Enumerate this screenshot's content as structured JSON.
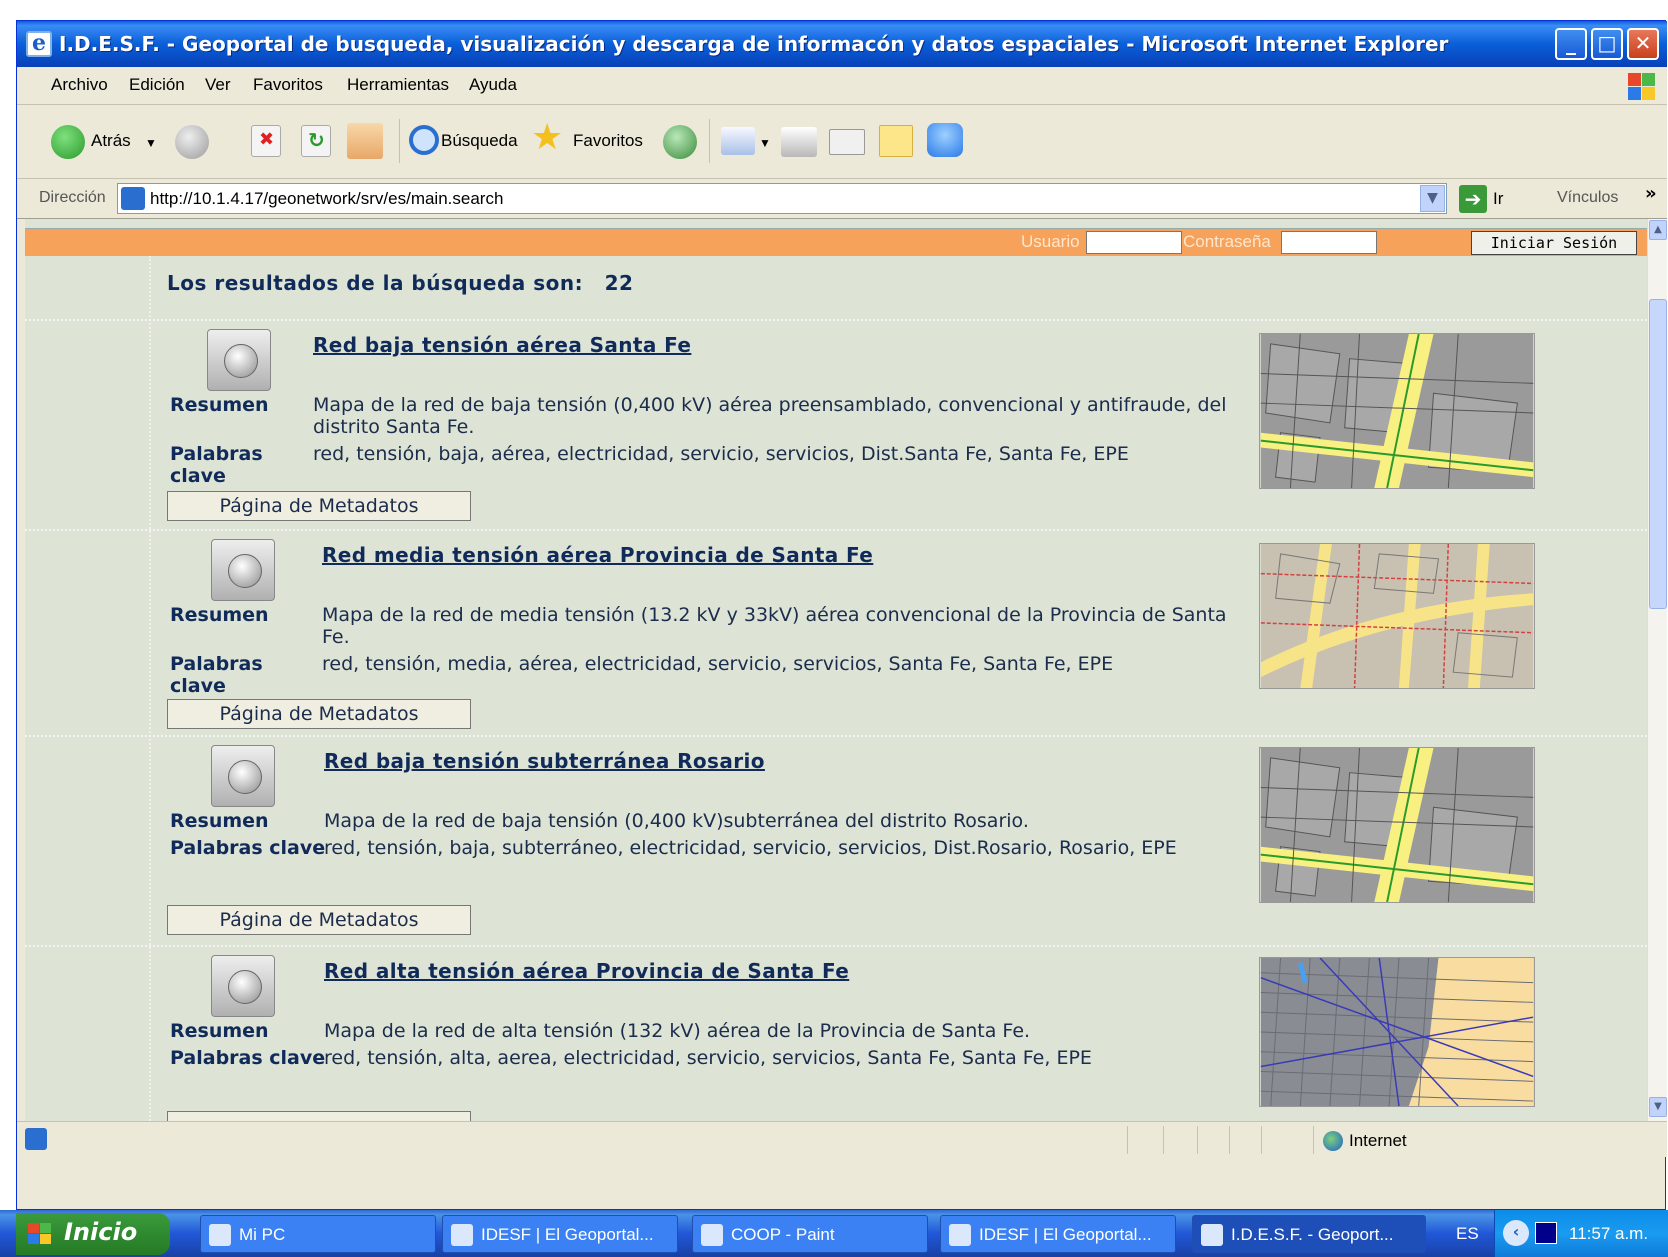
{
  "window": {
    "title": "I.D.E.S.F. - Geoportal de busqueda, visualización y descarga de informacón y datos espaciales - Microsoft Internet Explorer"
  },
  "menu": [
    "Archivo",
    "Edición",
    "Ver",
    "Favoritos",
    "Herramientas",
    "Ayuda"
  ],
  "toolbar": {
    "back_label": "Atrás",
    "search_label": "Búsqueda",
    "favorites_label": "Favoritos"
  },
  "address": {
    "label": "Dirección",
    "url": "http://10.1.4.17/geonetwork/srv/es/main.search",
    "go_label": "Ir",
    "links_label": "Vínculos"
  },
  "login": {
    "user_label": "Usuario",
    "password_label": "Contraseña",
    "button_label": "Iniciar Sesión"
  },
  "results": {
    "heading": "Los resultados de la búsqueda son:",
    "count": "22",
    "summary_label": "Resumen",
    "keywords_label": "Palabras clave",
    "metadata_button": "Página de Metadatos",
    "items": [
      {
        "title": "Red baja tensión aérea Santa Fe",
        "summary": "Mapa de la red de baja tensión (0,400 kV) aérea preensamblado, convencional y antifraude, del distrito Santa Fe.",
        "keywords": "red, tensión, baja, aérea, electricidad, servicio, servicios, Dist.Santa Fe, Santa Fe, EPE"
      },
      {
        "title": "Red media tensión aérea Provincia de Santa Fe",
        "summary": "Mapa de la red de media tensión (13.2 kV y 33kV) aérea convencional de la Provincia de Santa Fe.",
        "keywords": "red, tensión, media, aérea, electricidad, servicio, servicios, Santa Fe, Santa Fe, EPE"
      },
      {
        "title": "Red baja tensión subterránea Rosario",
        "summary": "Mapa de la red de baja tensión (0,400 kV)subterránea del distrito Rosario.",
        "keywords": "red, tensión, baja, subterráneo, electricidad, servicio, servicios, Dist.Rosario, Rosario, EPE"
      },
      {
        "title": "Red alta tensión aérea Provincia de Santa Fe",
        "summary": "Mapa de la red de alta tensión (132 kV) aérea de la Provincia de Santa Fe.",
        "keywords": "red, tensión, alta, aerea, electricidad, servicio, servicios, Santa Fe, Santa Fe, EPE"
      }
    ]
  },
  "status": {
    "zone": "Internet"
  },
  "taskbar": {
    "start_label": "Inicio",
    "buttons": [
      "Mi PC",
      "IDESF | El Geoportal...",
      "COOP - Paint",
      "IDESF | El Geoportal...",
      "I.D.E.S.F. - Geoport..."
    ],
    "language": "ES",
    "clock": "11:57 a.m."
  },
  "colors": {
    "titlebar": "#0a5fd8",
    "login_bar": "#f7a25a",
    "content_bg": "#dde3d5",
    "link": "#102a5a"
  }
}
